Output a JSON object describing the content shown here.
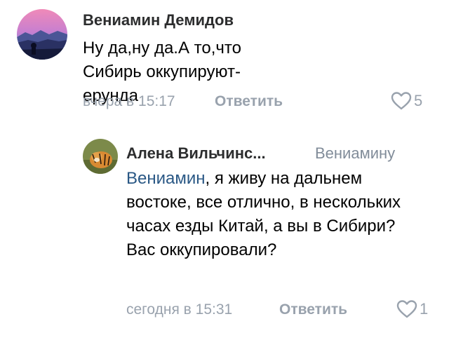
{
  "comments": [
    {
      "author": "Вениамин Демидов",
      "text": "Ну да,ну да.А то,что Сибирь оккупируют-ерунда",
      "time": "вчера в 15:17",
      "reply_label": "Ответить",
      "likes": "5"
    }
  ],
  "reply": {
    "author": "Алена Вильчинс...",
    "reply_to": "Вениамину",
    "mention": "Вениамин",
    "text": ", я живу на дальнем востоке, все отлично, в нескольких часах езды Китай, а вы в Сибири? Вас оккупировали?",
    "time": "сегодня в 15:31",
    "reply_label": "Ответить",
    "likes": "1"
  },
  "colors": {
    "link": "#2a5885",
    "meta": "#99a2ad",
    "author": "#2c2d2e"
  },
  "icons": [
    "heart-icon"
  ]
}
